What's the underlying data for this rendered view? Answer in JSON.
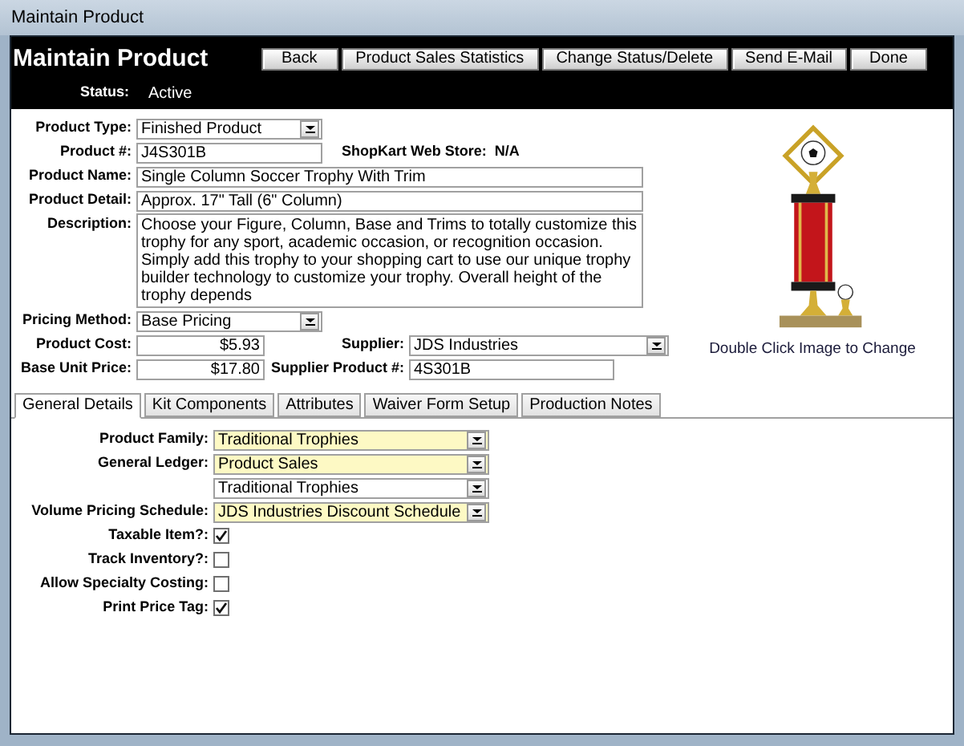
{
  "window": {
    "title": "Maintain Product"
  },
  "header": {
    "title": "Maintain Product",
    "buttons": [
      "Back",
      "Product Sales Statistics",
      "Change Status/Delete",
      "Send E-Mail",
      "Done"
    ],
    "status": {
      "label": "Status:",
      "value": "Active"
    }
  },
  "product": {
    "product_type": {
      "label": "Product Type:",
      "kind": "dropdown",
      "value": "Finished Product"
    },
    "product_number": {
      "label": "Product #:",
      "kind": "text",
      "value": "J4S301B"
    },
    "shopkart_web_store": {
      "label": "ShopKart Web Store:",
      "value": "N/A"
    },
    "product_name": {
      "label": "Product Name:",
      "kind": "text",
      "value": "Single Column Soccer Trophy With Trim"
    },
    "product_detail": {
      "label": "Product Detail:",
      "kind": "text",
      "value": "Approx. 17\" Tall (6\" Column)"
    },
    "description": {
      "label": "Description:",
      "kind": "textarea",
      "value": "Choose your Figure, Column, Base and Trims to totally customize this trophy for any sport, academic occasion, or recognition occasion. Simply add this trophy to your shopping cart to use our unique trophy builder technology to customize your trophy. Overall height of the trophy depends"
    },
    "pricing_method": {
      "label": "Pricing Method:",
      "kind": "dropdown",
      "value": "Base Pricing"
    },
    "product_cost": {
      "label": "Product Cost:",
      "kind": "text",
      "value": "$5.93"
    },
    "supplier": {
      "label": "Supplier:",
      "kind": "dropdown",
      "value": "JDS Industries"
    },
    "base_unit_price": {
      "label": "Base Unit Price:",
      "kind": "text",
      "value": "$17.80"
    },
    "supplier_product_number": {
      "label": "Supplier Product #:",
      "kind": "text",
      "value": "4S301B"
    }
  },
  "image": {
    "caption": "Double Click Image to Change"
  },
  "tabs": [
    {
      "label": "General Details",
      "selected": true
    },
    {
      "label": "Kit Components",
      "selected": false
    },
    {
      "label": "Attributes",
      "selected": false
    },
    {
      "label": "Waiver Form Setup",
      "selected": false
    },
    {
      "label": "Production Notes",
      "selected": false
    }
  ],
  "general_details": {
    "fields": [
      {
        "label": "Product Family:",
        "value": "Traditional Trophies",
        "highlighted": true
      },
      {
        "label": "General Ledger:",
        "value": "Product Sales",
        "highlighted": true
      },
      {
        "value": "Traditional Trophies",
        "highlighted": false
      },
      {
        "label": "Volume Pricing Schedule:",
        "value": "JDS Industries Discount Schedule",
        "highlighted": true
      }
    ],
    "checkboxes": [
      {
        "label": "Taxable Item?:",
        "checked": true
      },
      {
        "label": "Track Inventory?:",
        "checked": false
      },
      {
        "label": "Allow Specialty Costing:",
        "checked": false
      },
      {
        "label": "Print Price Tag:",
        "checked": true
      }
    ]
  }
}
